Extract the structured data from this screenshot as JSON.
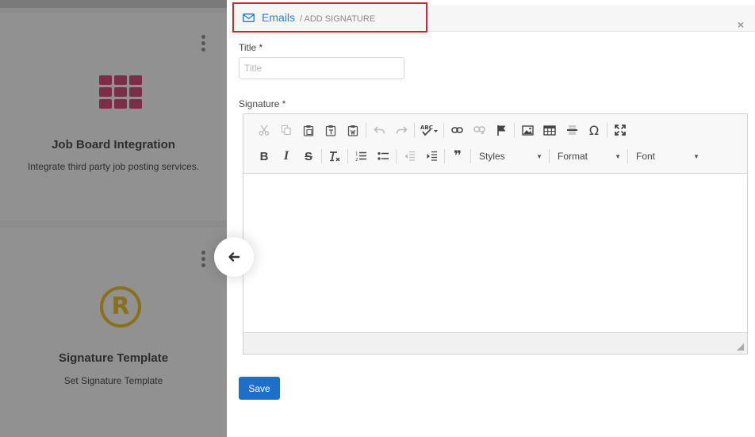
{
  "background": {
    "cards": [
      {
        "title": "Job Board Integration",
        "description": "Integrate third party job posting services.",
        "icon": "grid-icon"
      },
      {
        "title": "Signature Template",
        "description": "Set Signature Template",
        "icon": "registered-icon",
        "glyph": "R"
      }
    ]
  },
  "panel": {
    "breadcrumb": {
      "title": "Emails",
      "subtitle": "/ ADD SIGNATURE"
    },
    "close_glyph": "×",
    "form": {
      "title_label": "Title *",
      "title_placeholder": "Title",
      "title_value": "",
      "signature_label": "Signature *"
    },
    "editor": {
      "toolbar_row1": [
        "cut",
        "copy",
        "paste",
        "paste-text",
        "paste-word",
        "undo",
        "redo",
        "spellcheck",
        "link",
        "unlink",
        "anchor",
        "image",
        "table",
        "horizontal-line",
        "special-char",
        "maximize"
      ],
      "toolbar_row2": [
        "bold",
        "italic",
        "strike",
        "remove-format",
        "numbered-list",
        "bulleted-list",
        "outdent",
        "indent",
        "blockquote"
      ],
      "combos": {
        "styles": "Styles",
        "format": "Format",
        "font": "Font"
      },
      "glyphs": {
        "bold": "B",
        "italic": "I",
        "strike": "S",
        "omega": "Ω",
        "quote": "❞"
      }
    },
    "save_label": "Save"
  },
  "colors": {
    "accent": "#1d6fc9",
    "highlight_border": "#d2232a",
    "link": "#2e7fc6"
  }
}
